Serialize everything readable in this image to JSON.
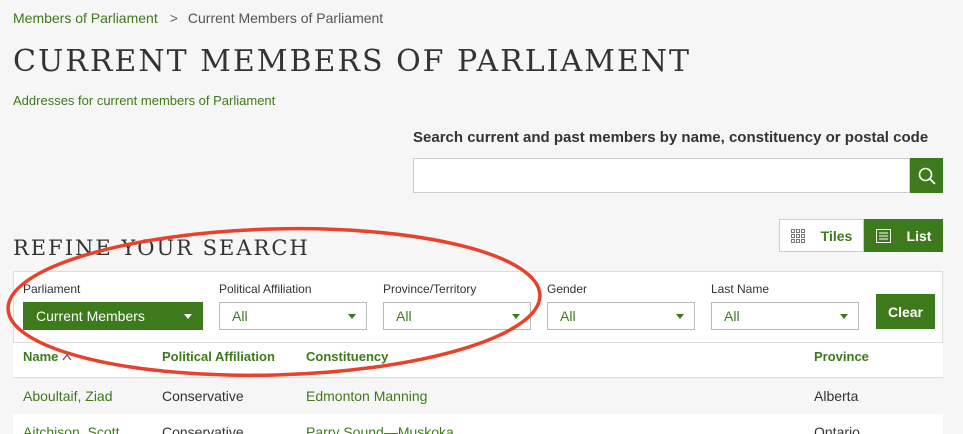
{
  "breadcrumb": {
    "parent": "Members of Parliament",
    "separator": ">",
    "current": "Current Members of Parliament"
  },
  "page": {
    "title": "CURRENT MEMBERS OF PARLIAMENT",
    "subtitle_link": "Addresses for current members of Parliament"
  },
  "search": {
    "label": "Search current and past members by name, constituency or postal code",
    "value": "",
    "placeholder": ""
  },
  "view_toggle": {
    "tiles_label": "Tiles",
    "list_label": "List",
    "selected": "List"
  },
  "refine": {
    "title": "REFINE YOUR SEARCH",
    "filters": [
      {
        "label": "Parliament",
        "value": "Current Members"
      },
      {
        "label": "Political Affiliation",
        "value": "All"
      },
      {
        "label": "Province/Territory",
        "value": "All"
      },
      {
        "label": "Gender",
        "value": "All"
      },
      {
        "label": "Last Name",
        "value": "All"
      }
    ],
    "clear_label": "Clear"
  },
  "table": {
    "headers": {
      "name": "Name",
      "affiliation": "Political Affiliation",
      "constituency": "Constituency",
      "province": "Province"
    },
    "rows": [
      {
        "name": "Aboultaif, Ziad",
        "affiliation": "Conservative",
        "constituency": "Edmonton Manning",
        "province": "Alberta"
      },
      {
        "name": "Aitchison, Scott",
        "affiliation": "Conservative",
        "constituency": "Parry Sound—Muskoka",
        "province": "Ontario"
      }
    ]
  },
  "colors": {
    "accent": "#3d7a1c",
    "annotation": "#e8412c"
  }
}
